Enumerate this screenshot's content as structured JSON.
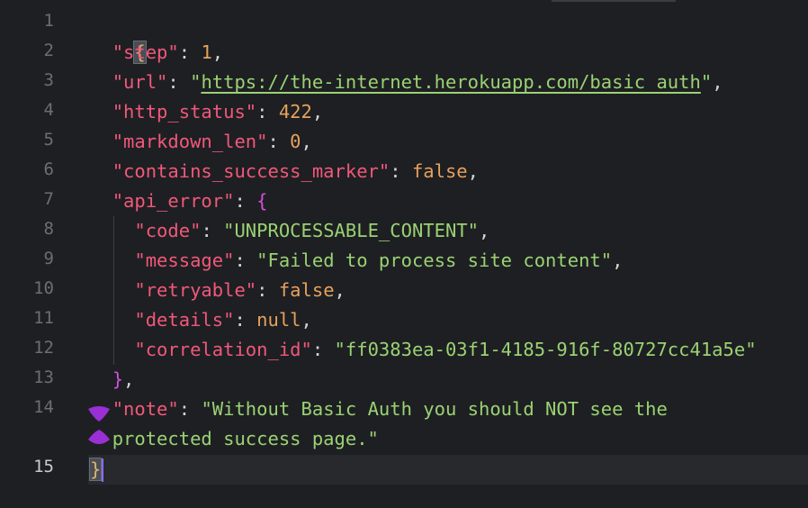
{
  "line_numbers": [
    "1",
    "2",
    "3",
    "4",
    "5",
    "6",
    "7",
    "8",
    "9",
    "10",
    "11",
    "12",
    "13",
    "14",
    "15"
  ],
  "code": {
    "l1_open": "{",
    "step_key": "\"step\"",
    "step_val": "1",
    "url_key": "\"url\"",
    "url_val": "https://the-internet.herokuapp.com/basic_auth",
    "http_status_key": "\"http_status\"",
    "http_status_val": "422",
    "markdown_len_key": "\"markdown_len\"",
    "markdown_len_val": "0",
    "contains_key": "\"contains_success_marker\"",
    "contains_val": "false",
    "api_error_key": "\"api_error\"",
    "api_error_open": "{",
    "code_key": "\"code\"",
    "code_val": "\"UNPROCESSABLE_CONTENT\"",
    "message_key": "\"message\"",
    "message_val": "\"Failed to process site content\"",
    "retryable_key": "\"retryable\"",
    "retryable_val": "false",
    "details_key": "\"details\"",
    "details_val": "null",
    "correlation_key": "\"correlation_id\"",
    "correlation_val": "\"ff0383ea-03f1-4185-916f-80727cc41a5e\"",
    "api_error_close": "}",
    "note_key": "\"note\"",
    "note_val_1": "\"Without Basic Auth you should NOT see the",
    "note_val_2": "protected success page.\"",
    "l15_close": "}"
  },
  "colors": {
    "background": "#1e1f22",
    "key": "#f1587b",
    "string": "#9ad274",
    "number": "#e6a15e",
    "brace_outer": "#e0b46b",
    "brace_inner": "#d44fe0",
    "caret": "#8a6bff"
  },
  "cursor": {
    "line": "15"
  }
}
